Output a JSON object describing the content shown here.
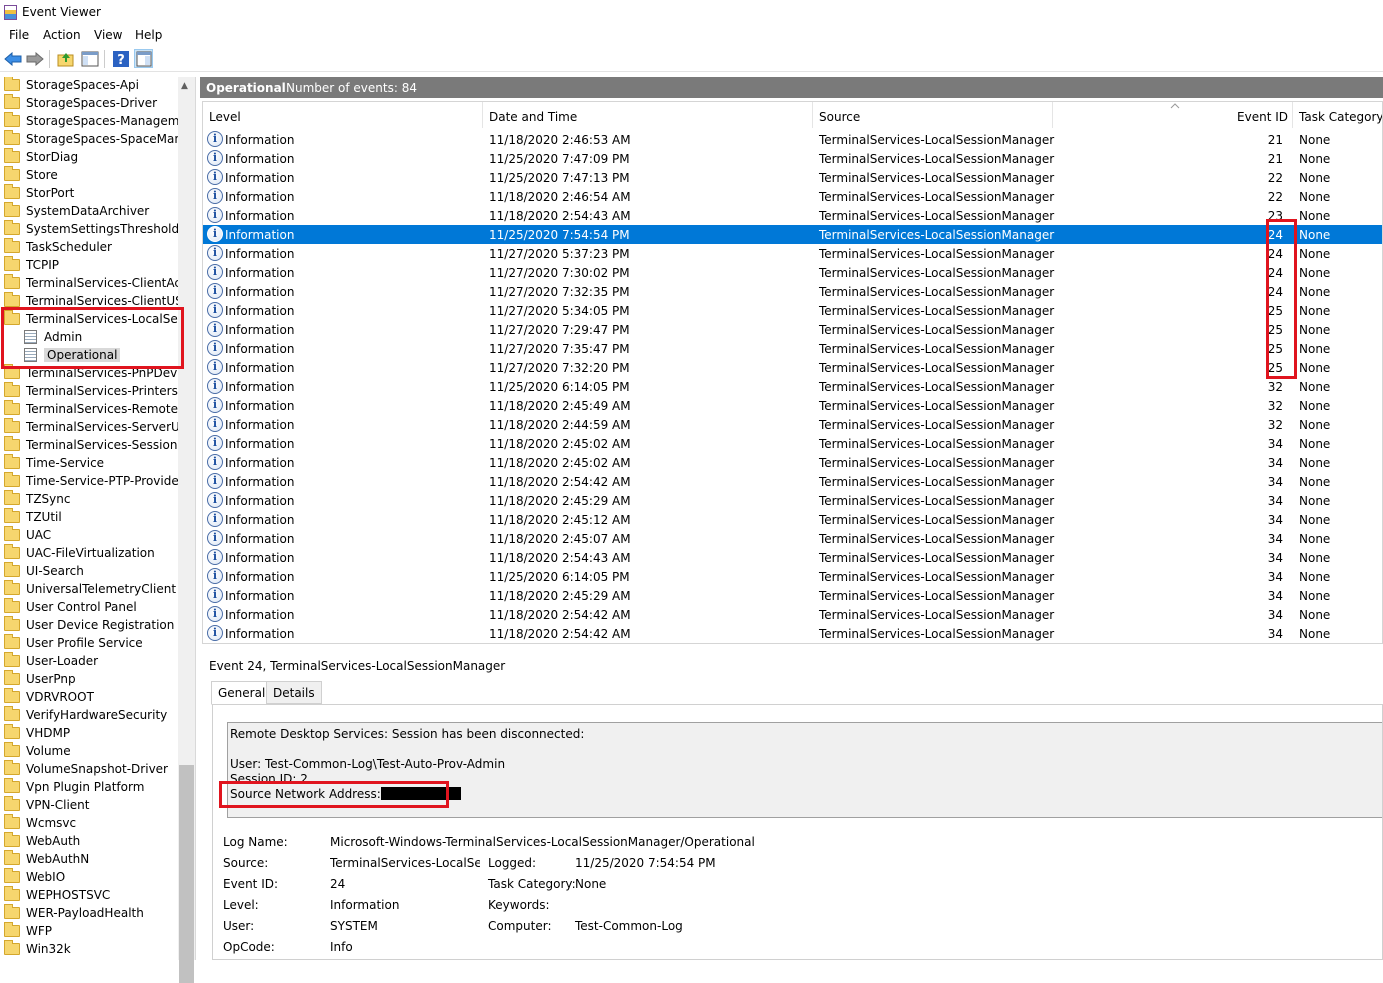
{
  "window": {
    "title": "Event Viewer"
  },
  "menu": [
    "File",
    "Action",
    "View",
    "Help"
  ],
  "tree": {
    "items": [
      {
        "label": "StorageSpaces-Api",
        "type": "folder"
      },
      {
        "label": "StorageSpaces-Driver",
        "type": "folder"
      },
      {
        "label": "StorageSpaces-ManagementAgent",
        "type": "folder"
      },
      {
        "label": "StorageSpaces-SpaceManager",
        "type": "folder"
      },
      {
        "label": "StorDiag",
        "type": "folder"
      },
      {
        "label": "Store",
        "type": "folder"
      },
      {
        "label": "StorPort",
        "type": "folder"
      },
      {
        "label": "SystemDataArchiver",
        "type": "folder"
      },
      {
        "label": "SystemSettingsThreshold",
        "type": "folder"
      },
      {
        "label": "TaskScheduler",
        "type": "folder"
      },
      {
        "label": "TCPIP",
        "type": "folder"
      },
      {
        "label": "TerminalServices-ClientActiveXCore",
        "type": "folder"
      },
      {
        "label": "TerminalServices-ClientUSBDevices",
        "type": "folder"
      },
      {
        "label": "TerminalServices-LocalSessionManager",
        "type": "folder-open"
      },
      {
        "label": "Admin",
        "type": "log"
      },
      {
        "label": "Operational",
        "type": "log",
        "selected": true
      },
      {
        "label": "TerminalServices-PnPDevices",
        "type": "folder"
      },
      {
        "label": "TerminalServices-Printers",
        "type": "folder"
      },
      {
        "label": "TerminalServices-RemoteConnectionManager",
        "type": "folder"
      },
      {
        "label": "TerminalServices-ServerUSBDevices",
        "type": "folder"
      },
      {
        "label": "TerminalServices-SessionBroker-Client",
        "type": "folder"
      },
      {
        "label": "Time-Service",
        "type": "folder"
      },
      {
        "label": "Time-Service-PTP-Provider",
        "type": "folder"
      },
      {
        "label": "TZSync",
        "type": "folder"
      },
      {
        "label": "TZUtil",
        "type": "folder"
      },
      {
        "label": "UAC",
        "type": "folder"
      },
      {
        "label": "UAC-FileVirtualization",
        "type": "folder"
      },
      {
        "label": "UI-Search",
        "type": "folder"
      },
      {
        "label": "UniversalTelemetryClient",
        "type": "folder"
      },
      {
        "label": "User Control Panel",
        "type": "folder"
      },
      {
        "label": "User Device Registration",
        "type": "folder"
      },
      {
        "label": "User Profile Service",
        "type": "folder"
      },
      {
        "label": "User-Loader",
        "type": "folder"
      },
      {
        "label": "UserPnp",
        "type": "folder"
      },
      {
        "label": "VDRVROOT",
        "type": "folder"
      },
      {
        "label": "VerifyHardwareSecurity",
        "type": "folder"
      },
      {
        "label": "VHDMP",
        "type": "folder"
      },
      {
        "label": "Volume",
        "type": "folder"
      },
      {
        "label": "VolumeSnapshot-Driver",
        "type": "folder"
      },
      {
        "label": "Vpn Plugin Platform",
        "type": "folder"
      },
      {
        "label": "VPN-Client",
        "type": "folder"
      },
      {
        "label": "Wcmsvc",
        "type": "folder"
      },
      {
        "label": "WebAuth",
        "type": "folder"
      },
      {
        "label": "WebAuthN",
        "type": "folder"
      },
      {
        "label": "WebIO",
        "type": "folder"
      },
      {
        "label": "WEPHOSTSVC",
        "type": "folder"
      },
      {
        "label": "WER-PayloadHealth",
        "type": "folder"
      },
      {
        "label": "WFP",
        "type": "folder"
      },
      {
        "label": "Win32k",
        "type": "folder"
      }
    ]
  },
  "pane": {
    "title": "Operational",
    "count": "Number of events: 84"
  },
  "columns": [
    "Level",
    "Date and Time",
    "Source",
    "Event ID",
    "Task Category"
  ],
  "events": [
    [
      "Information",
      "11/18/2020 2:46:53 AM",
      "TerminalServices-LocalSessionManager",
      "21",
      "None"
    ],
    [
      "Information",
      "11/25/2020 7:47:09 PM",
      "TerminalServices-LocalSessionManager",
      "21",
      "None"
    ],
    [
      "Information",
      "11/25/2020 7:47:13 PM",
      "TerminalServices-LocalSessionManager",
      "22",
      "None"
    ],
    [
      "Information",
      "11/18/2020 2:46:54 AM",
      "TerminalServices-LocalSessionManager",
      "22",
      "None"
    ],
    [
      "Information",
      "11/18/2020 2:54:43 AM",
      "TerminalServices-LocalSessionManager",
      "23",
      "None"
    ],
    [
      "Information",
      "11/25/2020 7:54:54 PM",
      "TerminalServices-LocalSessionManager",
      "24",
      "None"
    ],
    [
      "Information",
      "11/27/2020 5:37:23 PM",
      "TerminalServices-LocalSessionManager",
      "24",
      "None"
    ],
    [
      "Information",
      "11/27/2020 7:30:02 PM",
      "TerminalServices-LocalSessionManager",
      "24",
      "None"
    ],
    [
      "Information",
      "11/27/2020 7:32:35 PM",
      "TerminalServices-LocalSessionManager",
      "24",
      "None"
    ],
    [
      "Information",
      "11/27/2020 5:34:05 PM",
      "TerminalServices-LocalSessionManager",
      "25",
      "None"
    ],
    [
      "Information",
      "11/27/2020 7:29:47 PM",
      "TerminalServices-LocalSessionManager",
      "25",
      "None"
    ],
    [
      "Information",
      "11/27/2020 7:35:47 PM",
      "TerminalServices-LocalSessionManager",
      "25",
      "None"
    ],
    [
      "Information",
      "11/27/2020 7:32:20 PM",
      "TerminalServices-LocalSessionManager",
      "25",
      "None"
    ],
    [
      "Information",
      "11/25/2020 6:14:05 PM",
      "TerminalServices-LocalSessionManager",
      "32",
      "None"
    ],
    [
      "Information",
      "11/18/2020 2:45:49 AM",
      "TerminalServices-LocalSessionManager",
      "32",
      "None"
    ],
    [
      "Information",
      "11/18/2020 2:44:59 AM",
      "TerminalServices-LocalSessionManager",
      "32",
      "None"
    ],
    [
      "Information",
      "11/18/2020 2:45:02 AM",
      "TerminalServices-LocalSessionManager",
      "34",
      "None"
    ],
    [
      "Information",
      "11/18/2020 2:45:02 AM",
      "TerminalServices-LocalSessionManager",
      "34",
      "None"
    ],
    [
      "Information",
      "11/18/2020 2:54:42 AM",
      "TerminalServices-LocalSessionManager",
      "34",
      "None"
    ],
    [
      "Information",
      "11/18/2020 2:45:29 AM",
      "TerminalServices-LocalSessionManager",
      "34",
      "None"
    ],
    [
      "Information",
      "11/18/2020 2:45:12 AM",
      "TerminalServices-LocalSessionManager",
      "34",
      "None"
    ],
    [
      "Information",
      "11/18/2020 2:45:07 AM",
      "TerminalServices-LocalSessionManager",
      "34",
      "None"
    ],
    [
      "Information",
      "11/18/2020 2:54:43 AM",
      "TerminalServices-LocalSessionManager",
      "34",
      "None"
    ],
    [
      "Information",
      "11/25/2020 6:14:05 PM",
      "TerminalServices-LocalSessionManager",
      "34",
      "None"
    ],
    [
      "Information",
      "11/18/2020 2:45:29 AM",
      "TerminalServices-LocalSessionManager",
      "34",
      "None"
    ],
    [
      "Information",
      "11/18/2020 2:54:42 AM",
      "TerminalServices-LocalSessionManager",
      "34",
      "None"
    ],
    [
      "Information",
      "11/18/2020 2:54:42 AM",
      "TerminalServices-LocalSessionManager",
      "34",
      "None"
    ]
  ],
  "selected_row": 5,
  "detail": {
    "title": "Event 24, TerminalServices-LocalSessionManager",
    "tabs": [
      "General",
      "Details"
    ],
    "message": {
      "line1": "Remote Desktop Services: Session has been disconnected:",
      "line2": "User: Test-Common-Log\\Test-Auto-Prov-Admin",
      "line3": "Session ID: 2",
      "line4": "Source Network Address:"
    },
    "log_name_label": "Log Name:",
    "log_name": "Microsoft-Windows-TerminalServices-LocalSessionManager/Operational",
    "source_label": "Source:",
    "source": "TerminalServices-LocalSessi",
    "logged_label": "Logged:",
    "logged": "11/25/2020 7:54:54 PM",
    "event_id_label": "Event ID:",
    "event_id": "24",
    "task_category_label": "Task Category:",
    "task_category": "None",
    "level_label": "Level:",
    "level": "Information",
    "keywords_label": "Keywords:",
    "user_label": "User:",
    "user": "SYSTEM",
    "computer_label": "Computer:",
    "computer": "Test-Common-Log",
    "opcode_label": "OpCode:",
    "opcode": "Info"
  },
  "highlight_color": "#e0141e",
  "selection_color": "#0078d7"
}
